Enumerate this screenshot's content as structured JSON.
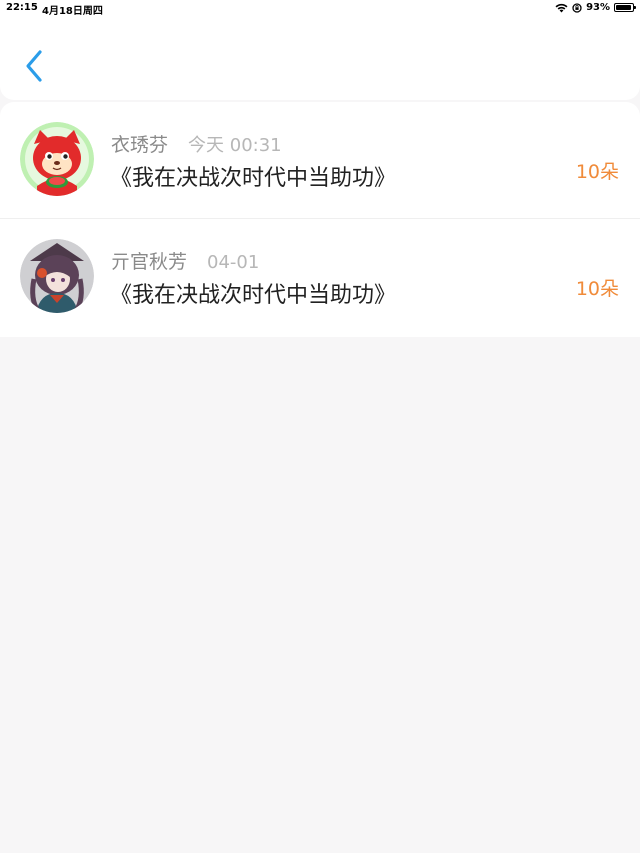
{
  "status_bar": {
    "time": "22:15",
    "date": "4月18日周四",
    "battery_percent": "93%",
    "battery_level": 0.93,
    "icons": [
      "wifi-icon",
      "orientation-lock-icon",
      "battery-icon"
    ]
  },
  "nav": {
    "back_icon": "chevron-left-icon",
    "accent_color": "#2b9de9"
  },
  "rows": [
    {
      "name": "衣琇芬",
      "time": "今天 00:31",
      "title": "《我在决战次时代中当助功》",
      "amount": "10朵",
      "avatar_icon": "red-fox-avatar"
    },
    {
      "name": "亓官秋芳",
      "time": "04-01",
      "title": "《我在决战次时代中当助功》",
      "amount": "10朵",
      "avatar_icon": "anime-girl-avatar"
    }
  ],
  "colors": {
    "amount": "#f08b3a",
    "name": "#8a8a8a",
    "time": "#b7b7b7",
    "title": "#222222",
    "background": "#f7f6f7"
  }
}
